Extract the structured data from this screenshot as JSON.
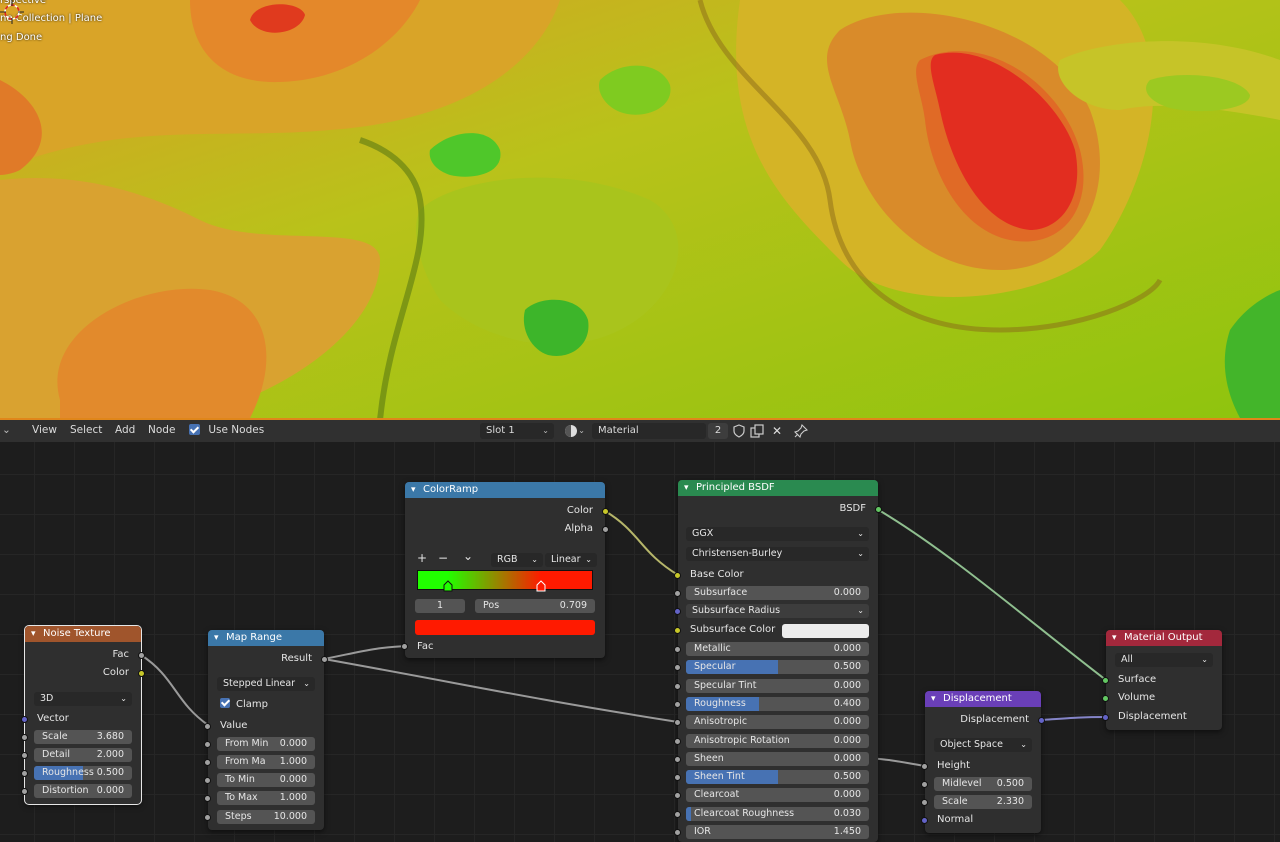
{
  "viewport": {
    "overlay_lines": [
      "rspective",
      "ne Collection | Plane",
      "ng Done"
    ]
  },
  "header": {
    "menu": [
      "View",
      "Select",
      "Add",
      "Node"
    ],
    "use_nodes_label": "Use Nodes",
    "slot": "Slot 1",
    "material_name": "Material",
    "users_count": "2"
  },
  "nodes": {
    "noise": {
      "title": "Noise Texture",
      "outputs": [
        "Fac",
        "Color"
      ],
      "dimensions": "3D",
      "vector_label": "Vector",
      "fields": [
        {
          "label": "Scale",
          "value": "3.680"
        },
        {
          "label": "Detail",
          "value": "2.000"
        },
        {
          "label": "Roughness",
          "value": "0.500",
          "fill": 0.5
        },
        {
          "label": "Distortion",
          "value": "0.000"
        }
      ]
    },
    "maprange": {
      "title": "Map Range",
      "output": "Result",
      "interpolation": "Stepped Linear",
      "clamp_label": "Clamp",
      "value_label": "Value",
      "fields": [
        {
          "label": "From Min",
          "value": "0.000"
        },
        {
          "label": "From Ma",
          "value": "1.000"
        },
        {
          "label": "To Min",
          "value": "0.000"
        },
        {
          "label": "To Max",
          "value": "1.000"
        },
        {
          "label": "Steps",
          "value": "10.000"
        }
      ]
    },
    "colorramp": {
      "title": "ColorRamp",
      "outputs": [
        "Color",
        "Alpha"
      ],
      "tools": [
        "+",
        "−",
        "⌄"
      ],
      "color_mode": "RGB",
      "interpolation": "Linear",
      "active_index": "1",
      "pos_label": "Pos",
      "pos_value": "0.709",
      "active_color": "#ff1a00",
      "fac_label": "Fac"
    },
    "bsdf": {
      "title": "Principled BSDF",
      "output": "BSDF",
      "distribution": "GGX",
      "sss_method": "Christensen-Burley",
      "base_color_label": "Base Color",
      "subsurface_radius_label": "Subsurface Radius",
      "subsurface_color_label": "Subsurface Color",
      "fields_a": [
        {
          "label": "Subsurface",
          "value": "0.000",
          "fill": 0
        }
      ],
      "fields_b": [
        {
          "label": "Metallic",
          "value": "0.000",
          "fill": 0
        },
        {
          "label": "Specular",
          "value": "0.500",
          "fill": 0.5
        },
        {
          "label": "Specular Tint",
          "value": "0.000",
          "fill": 0
        },
        {
          "label": "Roughness",
          "value": "0.400",
          "fill": 0.4
        },
        {
          "label": "Anisotropic",
          "value": "0.000",
          "fill": 0
        },
        {
          "label": "Anisotropic Rotation",
          "value": "0.000",
          "fill": 0
        },
        {
          "label": "Sheen",
          "value": "0.000",
          "fill": 0
        },
        {
          "label": "Sheen Tint",
          "value": "0.500",
          "fill": 0.5
        },
        {
          "label": "Clearcoat",
          "value": "0.000",
          "fill": 0
        },
        {
          "label": "Clearcoat Roughness",
          "value": "0.030",
          "fill": 0.03
        },
        {
          "label": "IOR",
          "value": "1.450",
          "fill": 0
        }
      ]
    },
    "displacement": {
      "title": "Displacement",
      "output": "Displacement",
      "space": "Object Space",
      "height_label": "Height",
      "normal_label": "Normal",
      "fields": [
        {
          "label": "Midlevel",
          "value": "0.500"
        },
        {
          "label": "Scale",
          "value": "2.330"
        }
      ]
    },
    "output": {
      "title": "Material Output",
      "target": "All",
      "inputs": [
        "Surface",
        "Volume",
        "Displacement"
      ]
    }
  },
  "colors": {
    "header_texture": "#a0552c",
    "header_converter": "#3b78a8",
    "header_shader": "#2a8a50",
    "header_vector": "#6a3fb8",
    "header_output": "#a3283c",
    "socket_float": "#a1a1a1",
    "socket_color": "#c7c729",
    "socket_vector": "#6363c7",
    "socket_shader": "#63c763",
    "accent": "#4772b3",
    "viewport_border": "#e0861a"
  }
}
